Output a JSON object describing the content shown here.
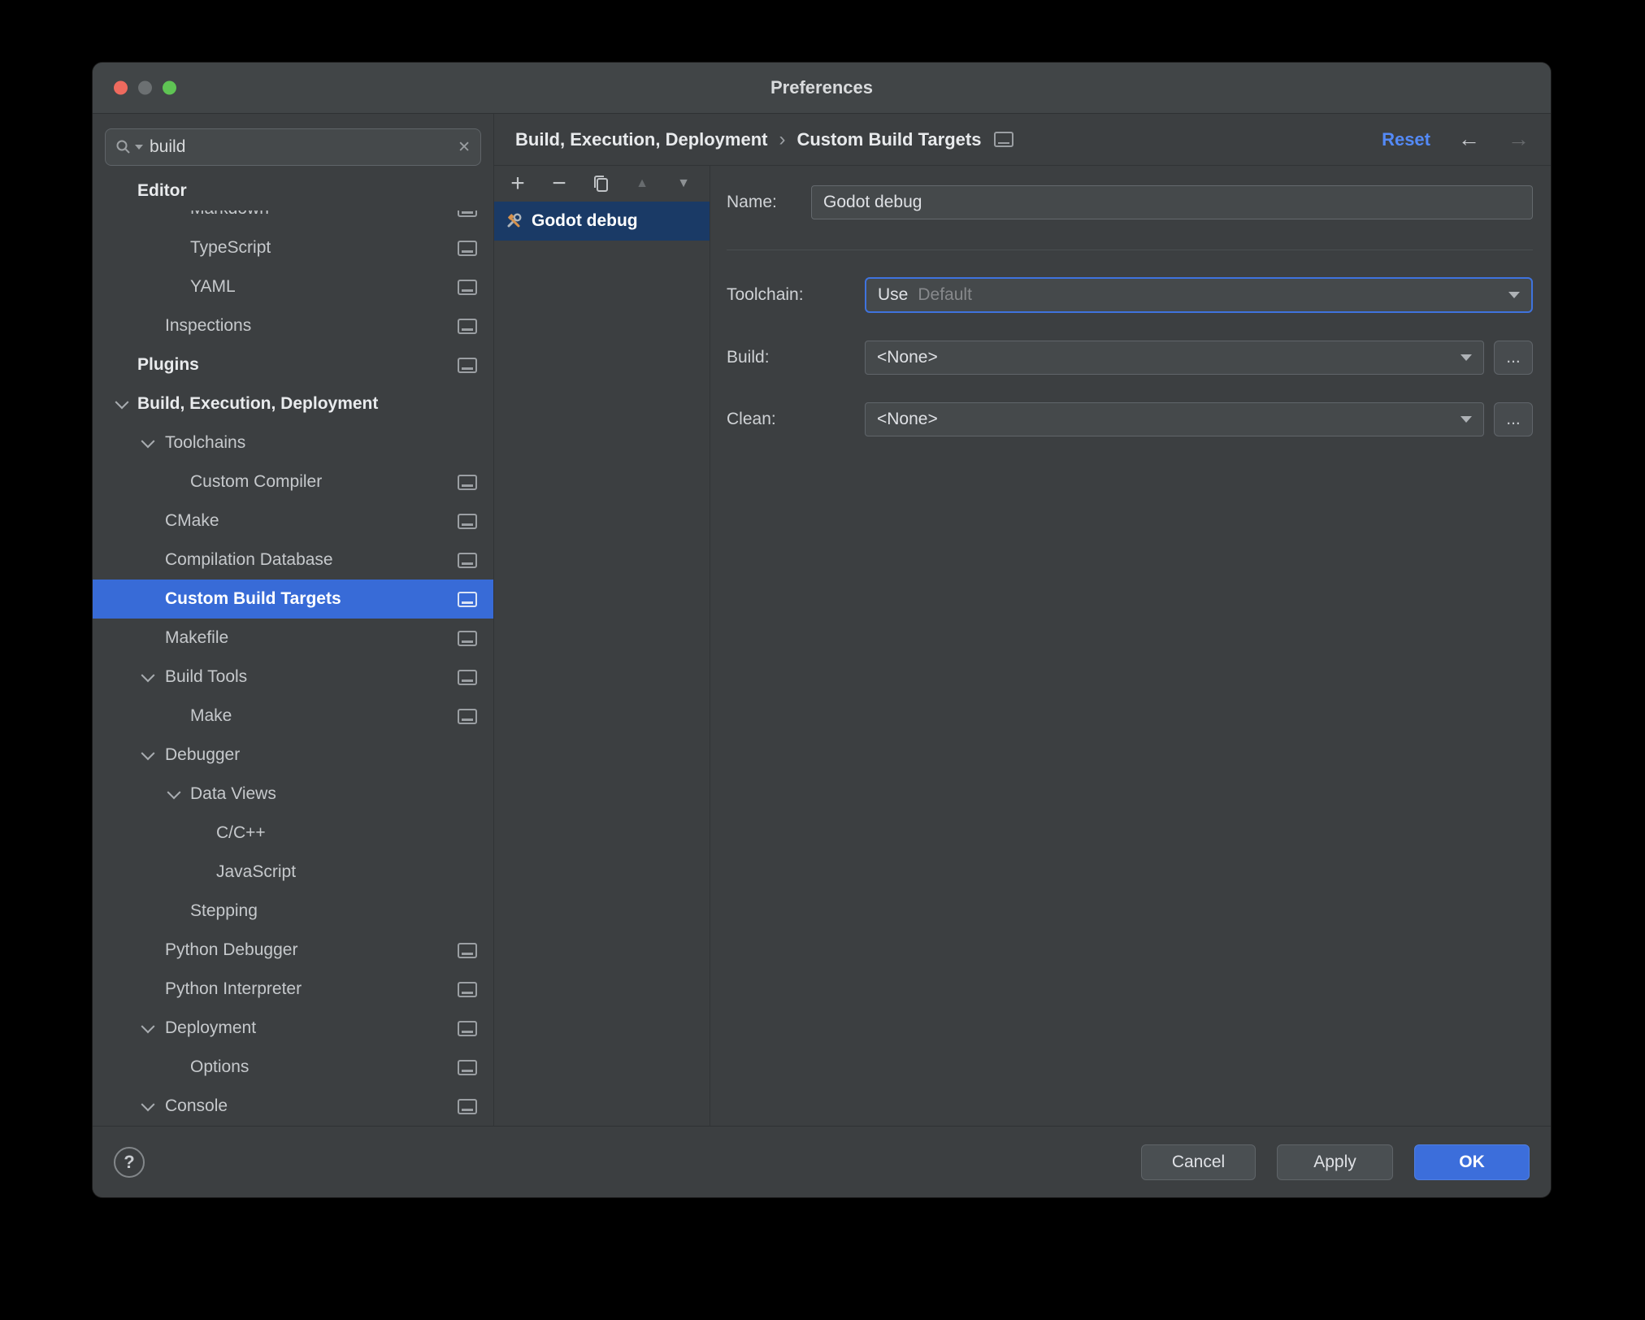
{
  "titlebar": {
    "title": "Preferences"
  },
  "search": {
    "value": "build",
    "clear": "✕"
  },
  "sidebar": {
    "items": [
      {
        "label": "Editor"
      },
      {
        "label": "Markdown"
      },
      {
        "label": "TypeScript"
      },
      {
        "label": "YAML"
      },
      {
        "label": "Inspections"
      },
      {
        "label": "Plugins"
      },
      {
        "label": "Build, Execution, Deployment"
      },
      {
        "label": "Toolchains"
      },
      {
        "label": "Custom Compiler"
      },
      {
        "label": "CMake"
      },
      {
        "label": "Compilation Database"
      },
      {
        "label": "Custom Build Targets",
        "selected": true
      },
      {
        "label": "Makefile"
      },
      {
        "label": "Build Tools"
      },
      {
        "label": "Make"
      },
      {
        "label": "Debugger"
      },
      {
        "label": "Data Views"
      },
      {
        "label": "C/C++"
      },
      {
        "label": "JavaScript"
      },
      {
        "label": "Stepping"
      },
      {
        "label": "Python Debugger"
      },
      {
        "label": "Python Interpreter"
      },
      {
        "label": "Deployment"
      },
      {
        "label": "Options"
      },
      {
        "label": "Console"
      }
    ]
  },
  "header": {
    "breadcrumb_parent": "Build, Execution, Deployment",
    "breadcrumb_sep": "›",
    "breadcrumb_current": "Custom Build Targets",
    "reset_label": "Reset",
    "back": "←",
    "forward": "→"
  },
  "targets": {
    "toolbar": {
      "add": "+",
      "remove": "−",
      "up": "▲",
      "down": "▼"
    },
    "selected_item": "Godot debug"
  },
  "form": {
    "name_label": "Name:",
    "name_value": "Godot debug",
    "toolchain_label": "Toolchain:",
    "toolchain_prefix": "Use",
    "toolchain_value": "Default",
    "build_label": "Build:",
    "build_value": "<None>",
    "clean_label": "Clean:",
    "clean_value": "<None>",
    "browse_label": "..."
  },
  "footer": {
    "help": "?",
    "cancel": "Cancel",
    "apply": "Apply",
    "ok": "OK"
  },
  "colors": {
    "accent_blue": "#386bd7",
    "link_blue": "#548af7",
    "selection_navy": "#1a3a66",
    "panel": "#3c3f41",
    "field": "#45494b"
  }
}
